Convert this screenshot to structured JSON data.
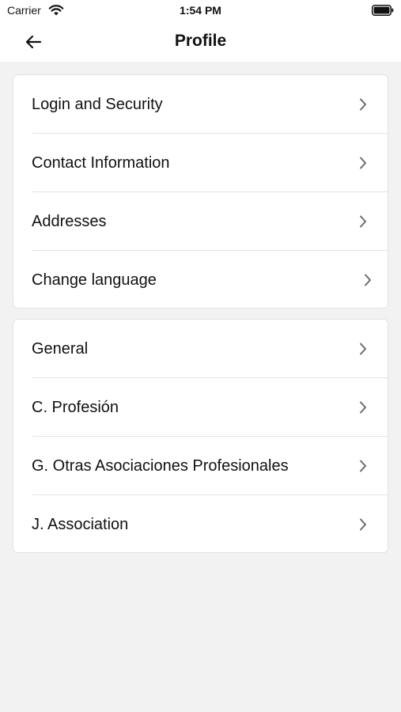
{
  "status_bar": {
    "carrier": "Carrier",
    "time": "1:54 PM",
    "icons": [
      "wifi-icon",
      "battery-icon"
    ]
  },
  "header": {
    "back_icon": "arrow-left-icon",
    "title": "Profile"
  },
  "sections": [
    {
      "items": [
        {
          "label": "Login and Security",
          "icon": "chevron-right-icon"
        },
        {
          "label": "Contact Information",
          "icon": "chevron-right-icon"
        },
        {
          "label": "Addresses",
          "icon": "chevron-right-icon"
        },
        {
          "label": "Change language",
          "icon": "chevron-right-icon"
        }
      ]
    },
    {
      "items": [
        {
          "label": "General",
          "icon": "chevron-right-icon"
        },
        {
          "label": "C. Profesión",
          "icon": "chevron-right-icon"
        },
        {
          "label": "G. Otras Asociaciones Profesionales",
          "icon": "chevron-right-icon"
        },
        {
          "label": "J. Association",
          "icon": "chevron-right-icon"
        }
      ]
    }
  ],
  "colors": {
    "background": "#f2f2f2",
    "card": "#ffffff",
    "text": "#111111",
    "chevron": "#6b6b6b",
    "divider": "#e3e3e3"
  }
}
